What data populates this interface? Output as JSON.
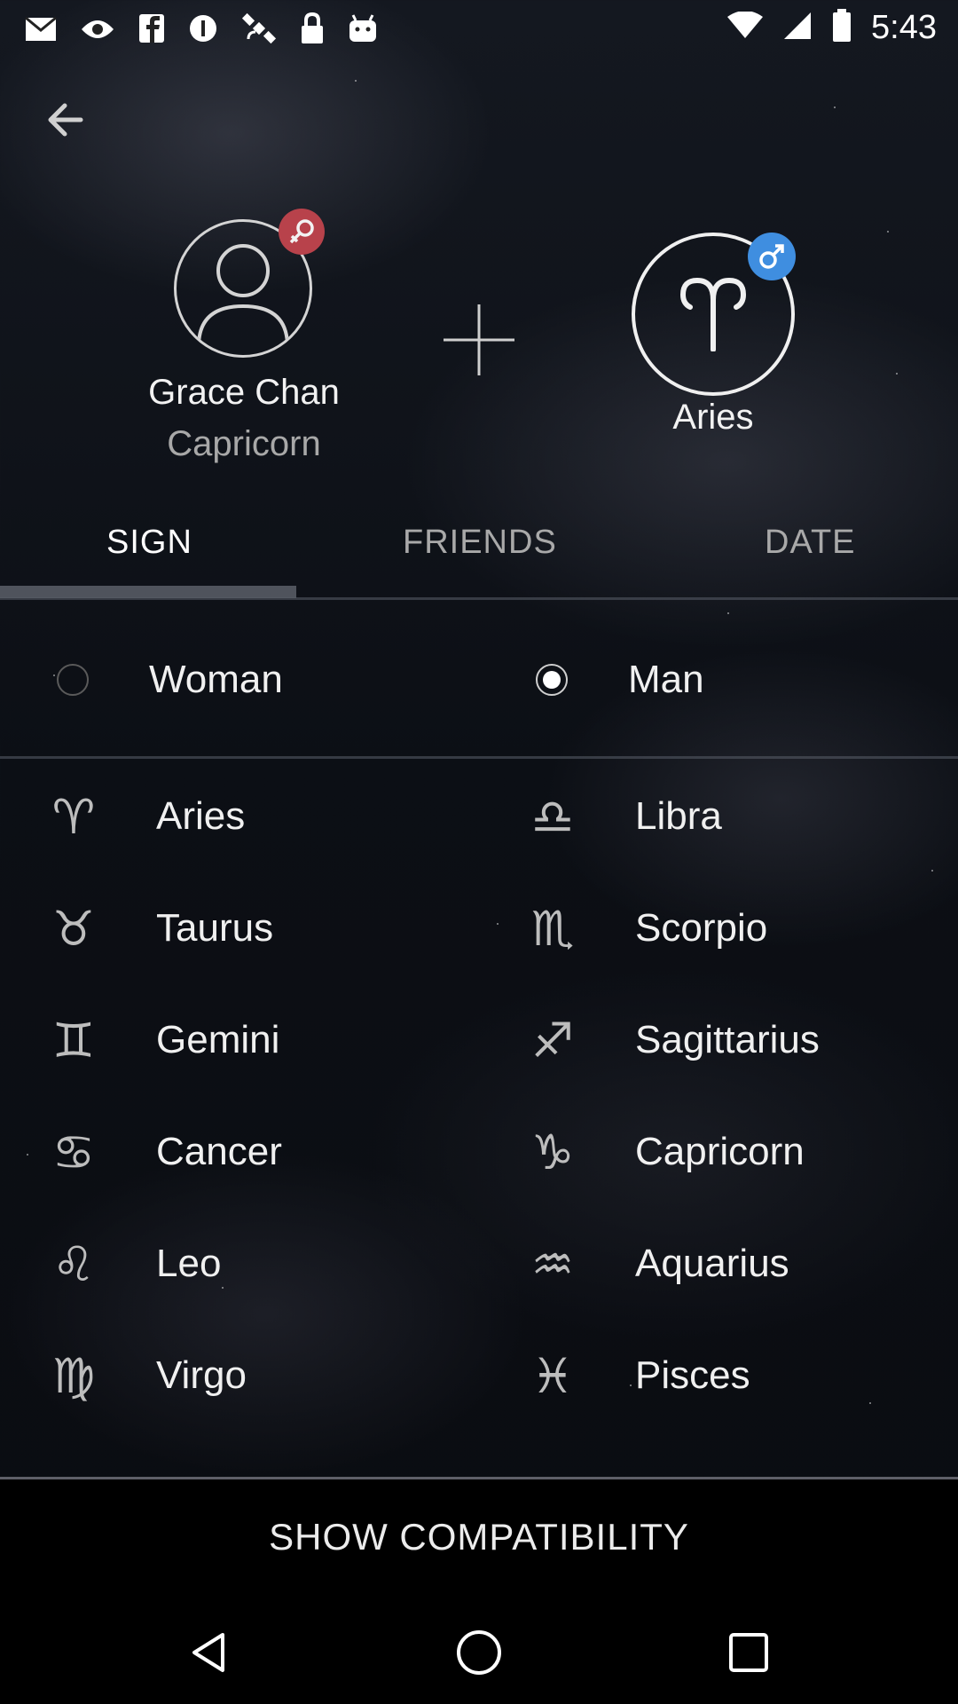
{
  "status_bar": {
    "time": "5:43",
    "icons": [
      "mail-icon",
      "eye-icon",
      "facebook-icon",
      "info-icon",
      "satellite-icon",
      "lock-icon",
      "android-icon"
    ]
  },
  "header": {
    "left_profile": {
      "name": "Grace Chan",
      "sign": "Capricorn",
      "gender_badge": "female"
    },
    "right_profile": {
      "sign": "Aries",
      "gender_badge": "male"
    }
  },
  "tabs": [
    {
      "label": "SIGN",
      "selected": true
    },
    {
      "label": "FRIENDS",
      "selected": false
    },
    {
      "label": "DATE",
      "selected": false
    }
  ],
  "gender_options": [
    {
      "label": "Woman",
      "selected": false
    },
    {
      "label": "Man",
      "selected": true
    }
  ],
  "zodiac_signs": {
    "left": [
      {
        "label": "Aries",
        "glyph": "♈"
      },
      {
        "label": "Taurus",
        "glyph": "♉"
      },
      {
        "label": "Gemini",
        "glyph": "♊"
      },
      {
        "label": "Cancer",
        "glyph": "♋"
      },
      {
        "label": "Leo",
        "glyph": "♌"
      },
      {
        "label": "Virgo",
        "glyph": "♍"
      }
    ],
    "right": [
      {
        "label": "Libra",
        "glyph": "♎"
      },
      {
        "label": "Scorpio",
        "glyph": "♏"
      },
      {
        "label": "Sagittarius",
        "glyph": "♐"
      },
      {
        "label": "Capricorn",
        "glyph": "♑"
      },
      {
        "label": "Aquarius",
        "glyph": "♒"
      },
      {
        "label": "Pisces",
        "glyph": "♓"
      }
    ]
  },
  "footer": {
    "button_label": "SHOW COMPATIBILITY"
  },
  "colors": {
    "female_badge": "#b8424b",
    "male_badge": "#3f8ee0",
    "background": "#0c0f15"
  }
}
